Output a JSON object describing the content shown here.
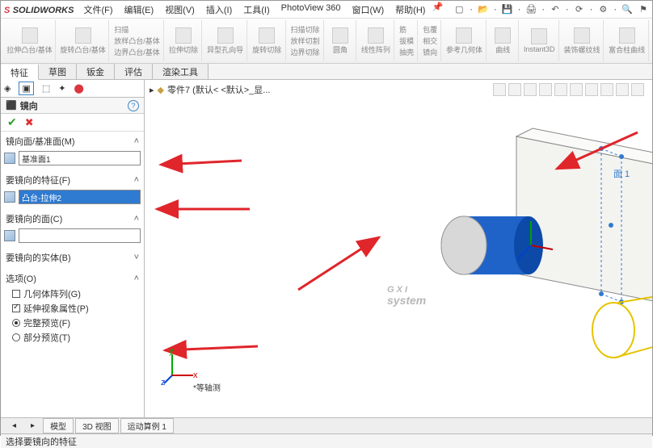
{
  "app": {
    "brand_prefix": "S",
    "brand": "SOLIDWORKS"
  },
  "menu": {
    "file": "文件(F)",
    "edit": "编辑(E)",
    "view": "视图(V)",
    "insert": "插入(I)",
    "tools": "工具(I)",
    "pv360": "PhotoView 360",
    "window": "窗口(W)",
    "help": "帮助(H)"
  },
  "ribbon": {
    "g1": "拉伸凸台/基体",
    "g2": "旋转凸台/基体",
    "c1a": "扫描",
    "c1b": "放样凸台/基体",
    "c1c": "边界凸台/基体",
    "g3": "拉伸切除",
    "g4": "异型孔向导",
    "g5": "旋转切除",
    "c2a": "扫描切除",
    "c2b": "放样切割",
    "c2c": "边界切除",
    "g6": "圆角",
    "g7": "线性阵列",
    "c3a": "筋",
    "c3b": "拔模",
    "c3c": "抽壳",
    "c4a": "包覆",
    "c4b": "相交",
    "c4c": "镜向",
    "g8": "参考几何体",
    "g9": "曲线",
    "g10": "Instant3D",
    "g11": "装饰螺纹线",
    "g12": "富合柱曲线"
  },
  "tabs": {
    "t1": "特征",
    "t2": "草图",
    "t3": "钣金",
    "t4": "评估",
    "t5": "渲染工具"
  },
  "breadcrumb": {
    "part": "零件7 (默认< <默认>_显..."
  },
  "panel": {
    "title": "镜向",
    "sec1": "镜向面/基准面(M)",
    "field1": "基准面1",
    "sec2": "要镜向的特征(F)",
    "field2": "凸台-拉伸2",
    "sec3": "要镜向的面(C)",
    "field3": "",
    "sec4": "要镜向的实体(B)",
    "sec5": "选项(O)",
    "opt1": "几何体阵列(G)",
    "opt2": "延伸视象属性(P)",
    "opt3": "完整预览(F)",
    "opt4": "部分预览(T)"
  },
  "viewport": {
    "orientation": "等轴测",
    "ref_label": "面 1"
  },
  "bottom_tabs": {
    "b1": "模型",
    "b2": "3D 视图",
    "b3": "运动算例 1"
  },
  "status": "选择要镜向的特征",
  "watermark": {
    "main": "G X I",
    "sub": "system"
  }
}
